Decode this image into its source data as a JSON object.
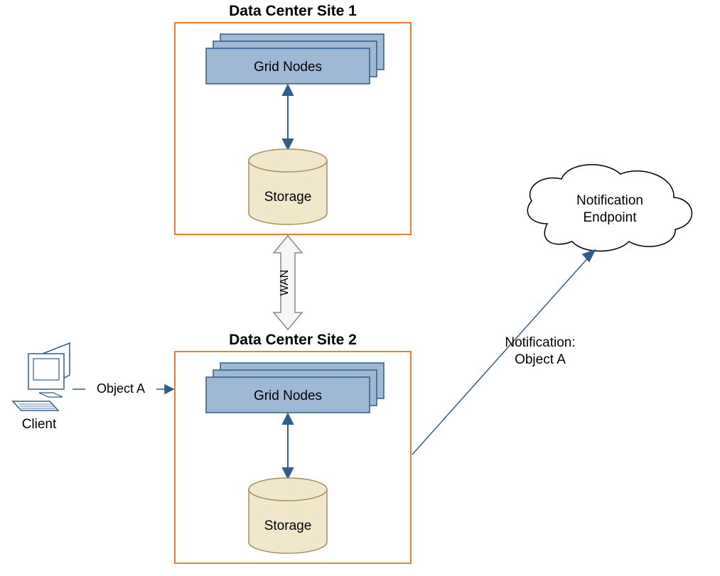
{
  "site1": {
    "title": "Data Center Site 1",
    "nodes": "Grid Nodes",
    "storage": "Storage"
  },
  "site2": {
    "title": "Data Center Site 2",
    "nodes": "Grid Nodes",
    "storage": "Storage"
  },
  "wan": "WAN",
  "client": {
    "label": "Client",
    "object_label": "Object A"
  },
  "notification": {
    "line1": "Notification:",
    "line2": "Object A"
  },
  "cloud": {
    "line1": "Notification",
    "line2": "Endpoint"
  },
  "colors": {
    "site_border": "#ED7D31",
    "node_fill": "#9EB9D4",
    "node_stroke": "#2F5E8C",
    "storage_fill": "#F1E8CB",
    "storage_stroke": "#A3905A",
    "arrow": "#2F5E8C",
    "cloud": "#000000",
    "client_fill": "#FFFFFF",
    "client_stroke": "#2F5E8C"
  }
}
